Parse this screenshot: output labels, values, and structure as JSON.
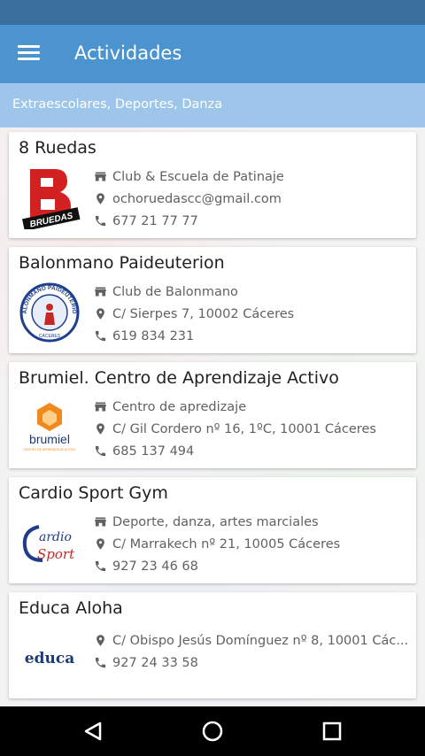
{
  "app": {
    "title": "Actividades",
    "filter_text": "Extraescolares, Deportes, Danza",
    "colors": {
      "statusbar": "#3a6f9d",
      "appbar": "#4c94cf",
      "subbar": "#9dc6ea"
    }
  },
  "cards": [
    {
      "title": "8 Ruedas",
      "category": "Club & Escuela de Patinaje",
      "address": "ochoruedascc@gmail.com",
      "phone": "677 21 77 77",
      "logo_text": "BRUEDAS"
    },
    {
      "title": "Balonmano Paideuterion",
      "category": "Club de Balonmano",
      "address": "C/ Sierpes 7, 10002 Cáceres",
      "phone": "619 834 231",
      "logo_text": "BALONMANO PAIDEUTERION",
      "logo_subtext": "CÁCERES"
    },
    {
      "title": "Brumiel. Centro de Aprendizaje Activo",
      "category": "Centro de apredizaje",
      "address": "C/ Gil Cordero nº 16, 1ºC, 10001  Cáceres",
      "phone": "685 137 494",
      "logo_text": "brumiel",
      "logo_subtext": "CENTRO DE APRENDIZAJE ACTIVO"
    },
    {
      "title": "Cardio Sport Gym",
      "category": "Deporte, danza, artes marciales",
      "address": "C/ Marrakech nº 21, 10005 Cáceres",
      "phone": "927 23 46 68",
      "logo_text": "ardio",
      "logo_subtext": "Sport"
    },
    {
      "title": "Educa Aloha",
      "address": "C/ Obispo Jesús Domínguez  nº 8, 10001 Các...",
      "phone": "927 24 33 58",
      "logo_text": "educa"
    }
  ],
  "icons": {
    "menu": "menu-icon",
    "category": "store-icon",
    "location": "location-pin-icon",
    "phone": "phone-icon",
    "nav_back": "back-triangle-icon",
    "nav_home": "home-circle-icon",
    "nav_recents": "recents-square-icon"
  }
}
